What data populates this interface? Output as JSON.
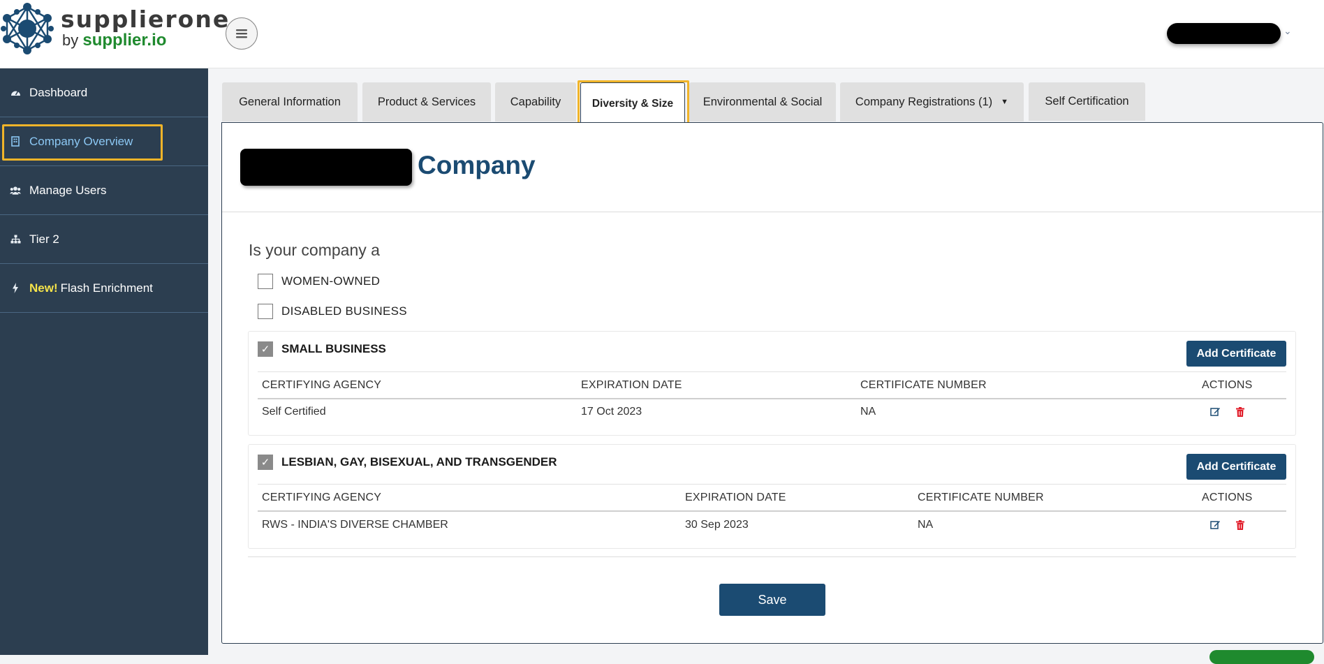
{
  "brand": {
    "title": "supplierone",
    "sub_prefix": "by",
    "sub_brand": "supplier.io"
  },
  "sidebar": {
    "items": [
      {
        "label": "Dashboard",
        "icon": "dashboard-icon"
      },
      {
        "label": "Company Overview",
        "icon": "building-icon",
        "active": true
      },
      {
        "label": "Manage Users",
        "icon": "users-icon"
      },
      {
        "label": "Tier 2",
        "icon": "sitemap-icon"
      },
      {
        "label": "Flash Enrichment",
        "badge": "New!",
        "icon": "bolt-icon"
      }
    ]
  },
  "tabs": [
    {
      "label": "General Information"
    },
    {
      "label": "Product & Services"
    },
    {
      "label": "Capability"
    },
    {
      "label": "Diversity & Size",
      "active": true
    },
    {
      "label": "Environmental & Social"
    },
    {
      "label": "Company Registrations (1)",
      "dropdown": true
    },
    {
      "label": "Self Certification"
    }
  ],
  "company": {
    "name_suffix": "Company"
  },
  "form": {
    "question": "Is your company a",
    "women_owned": {
      "label": "WOMEN-OWNED",
      "checked": false
    },
    "disabled_business": {
      "label": "DISABLED BUSINESS",
      "checked": false
    },
    "sections": [
      {
        "label": "SMALL BUSINESS",
        "checked": true,
        "add_label": "Add Certificate",
        "columns": [
          "CERTIFYING AGENCY",
          "EXPIRATION DATE",
          "CERTIFICATE NUMBER",
          "ACTIONS"
        ],
        "rows": [
          {
            "agency": "Self Certified",
            "expiration": "17 Oct 2023",
            "number": "NA"
          }
        ]
      },
      {
        "label": "LESBIAN, GAY, BISEXUAL, AND TRANSGENDER",
        "checked": true,
        "add_label": "Add Certificate",
        "columns": [
          "CERTIFYING AGENCY",
          "EXPIRATION DATE",
          "CERTIFICATE NUMBER",
          "ACTIONS"
        ],
        "rows": [
          {
            "agency": "RWS - INDIA'S DIVERSE CHAMBER",
            "expiration": "30 Sep 2023",
            "number": "NA"
          }
        ]
      }
    ],
    "save_label": "Save"
  },
  "colors": {
    "sidebar_bg": "#2c3e50",
    "primary": "#1b4b72",
    "highlight": "#f0b429",
    "brand_green": "#1f8a2e",
    "delete_red": "#e11d2a"
  }
}
